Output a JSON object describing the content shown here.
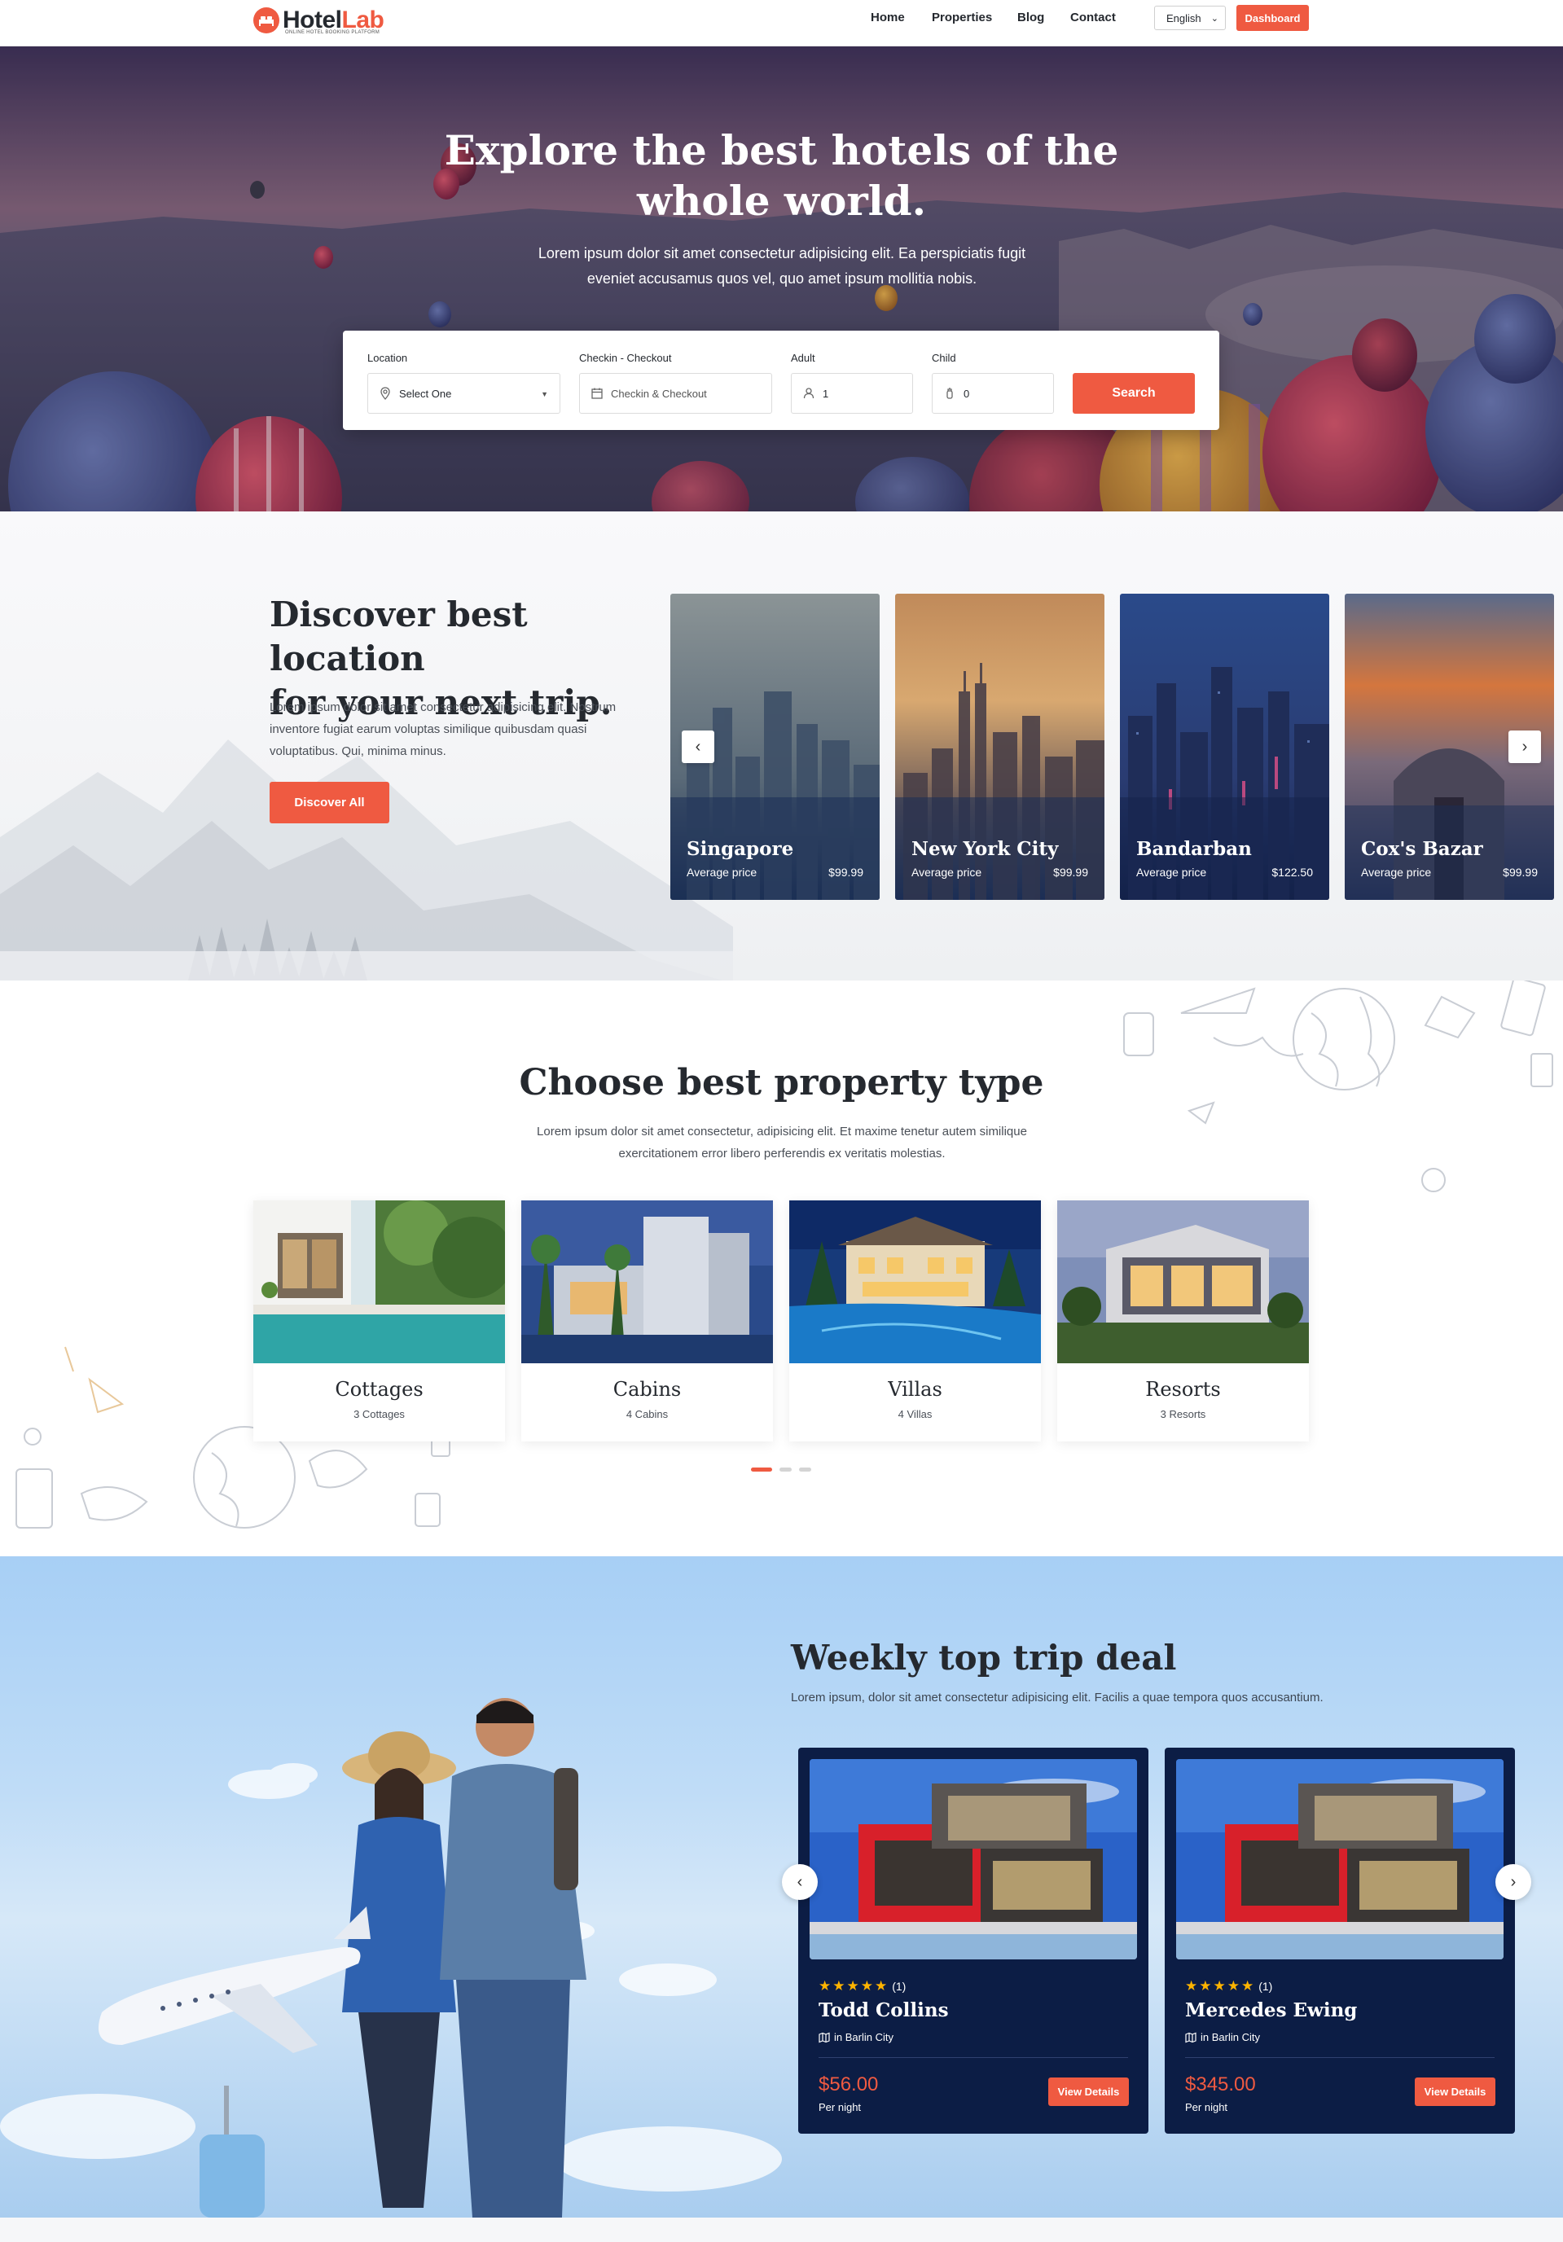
{
  "header": {
    "logo": {
      "part1": "Hotel",
      "part2": "Lab",
      "tagline": "ONLINE HOTEL BOOKING PLATFORM"
    },
    "nav": [
      "Home",
      "Properties",
      "Blog",
      "Contact"
    ],
    "language": "English",
    "dashboard_label": "Dashboard"
  },
  "hero": {
    "title_line1": "Explore the best hotels of the",
    "title_line2": "whole world.",
    "subtitle": "Lorem ipsum dolor sit amet consectetur adipisicing elit. Ea perspiciatis fugit eveniet accusamus quos vel, quo amet ipsum mollitia nobis."
  },
  "search": {
    "location": {
      "label": "Location",
      "value": "Select One"
    },
    "dates": {
      "label": "Checkin - Checkout",
      "placeholder": "Checkin & Checkout"
    },
    "adult": {
      "label": "Adult",
      "value": "1"
    },
    "child": {
      "label": "Child",
      "value": "0"
    },
    "button": "Search"
  },
  "discover": {
    "title_line1": "Discover best location",
    "title_line2": "for your next trip.",
    "text": "Lorem ipsum dolor sit amet consectetur adipisicing elit. Nostrum inventore fugiat earum voluptas similique quibusdam quasi voluptatibus. Qui, minima minus.",
    "button": "Discover All",
    "cities": [
      {
        "name": "Singapore",
        "avg_label": "Average price",
        "price": "$99.99"
      },
      {
        "name": "New York City",
        "avg_label": "Average price",
        "price": "$99.99"
      },
      {
        "name": "Bandarban",
        "avg_label": "Average price",
        "price": "$122.50"
      },
      {
        "name": "Cox's Bazar",
        "avg_label": "Average price",
        "price": "$99.99"
      }
    ]
  },
  "properties": {
    "title": "Choose best property type",
    "subtitle": "Lorem ipsum dolor sit amet consectetur, adipisicing elit. Et maxime tenetur autem similique exercitationem error libero perferendis ex veritatis molestias.",
    "types": [
      {
        "name": "Cottages",
        "count": "3 Cottages"
      },
      {
        "name": "Cabins",
        "count": "4 Cabins"
      },
      {
        "name": "Villas",
        "count": "4 Villas"
      },
      {
        "name": "Resorts",
        "count": "3 Resorts"
      }
    ]
  },
  "deals": {
    "title": "Weekly top trip deal",
    "subtitle": "Lorem ipsum, dolor sit amet consectetur adipisicing elit. Facilis a quae tempora quos accusantium.",
    "items": [
      {
        "stars": "★★★★★",
        "reviews": "(1)",
        "name": "Todd Collins",
        "location": "in Barlin City",
        "price": "$56.00",
        "per": "Per night",
        "button": "View Details"
      },
      {
        "stars": "★★★★★",
        "reviews": "(1)",
        "name": "Mercedes Ewing",
        "location": "in Barlin City",
        "price": "$345.00",
        "per": "Per night",
        "button": "View Details"
      }
    ]
  },
  "colors": {
    "accent": "#ef5a41",
    "navy": "#0c1d45",
    "text": "#25292f"
  }
}
